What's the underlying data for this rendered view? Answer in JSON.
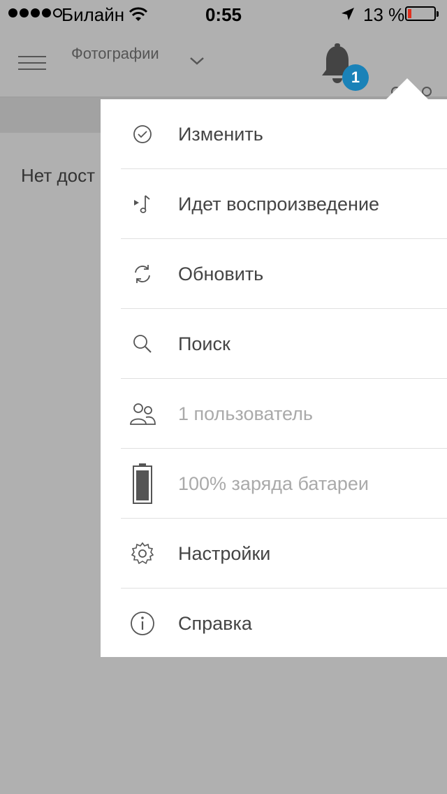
{
  "status_bar": {
    "carrier": "Билайн",
    "time": "0:55",
    "battery_percent": "13 %",
    "signal_filled": 4,
    "signal_total": 5,
    "battery_level": 0.13
  },
  "header": {
    "title": "Фотографии",
    "notification_count": "1"
  },
  "main": {
    "empty_message": "Нет дост"
  },
  "menu": {
    "items": [
      {
        "label": "Изменить",
        "icon": "check-circle-icon",
        "enabled": true
      },
      {
        "label": "Идет воспроизведение",
        "icon": "now-playing-icon",
        "enabled": true
      },
      {
        "label": "Обновить",
        "icon": "refresh-icon",
        "enabled": true
      },
      {
        "label": "Поиск",
        "icon": "search-icon",
        "enabled": true
      },
      {
        "label": "1 пользователь",
        "icon": "users-icon",
        "enabled": false
      },
      {
        "label": "100% заряда батареи",
        "icon": "battery-icon",
        "enabled": false
      },
      {
        "label": "Настройки",
        "icon": "gear-icon",
        "enabled": true
      },
      {
        "label": "Справка",
        "icon": "info-icon",
        "enabled": true
      }
    ]
  },
  "colors": {
    "overlay_background": "#b0b0b0",
    "menu_background": "#ffffff",
    "badge": "#1a82b8",
    "battery_low": "#e0301e",
    "text": "#444444",
    "disabled_text": "#aaaaaa"
  }
}
